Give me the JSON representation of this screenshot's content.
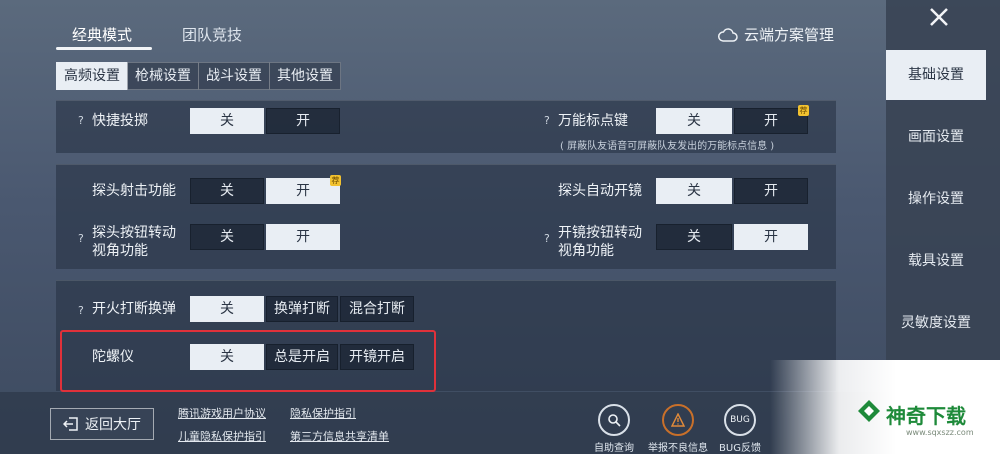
{
  "mode_tabs": [
    {
      "label": "经典模式",
      "active": true
    },
    {
      "label": "团队竞技",
      "active": false
    }
  ],
  "cloud": {
    "label": "云端方案管理",
    "icon": "cloud-icon"
  },
  "sub_tabs": [
    {
      "label": "高频设置",
      "active": true
    },
    {
      "label": "枪械设置",
      "active": false
    },
    {
      "label": "战斗设置",
      "active": false
    },
    {
      "label": "其他设置",
      "active": false
    }
  ],
  "settings": {
    "quick_throw": {
      "help": "?",
      "label": "快捷投掷",
      "options": [
        "关",
        "开"
      ],
      "selected": "关"
    },
    "universal_mark": {
      "help": "?",
      "label": "万能标点键",
      "options": [
        "关",
        "开"
      ],
      "selected": "关",
      "badge": "荐",
      "note": "( 屏蔽队友语音可屏蔽队友发出的万能标点信息 )"
    },
    "peek_fire": {
      "label": "探头射击功能",
      "options": [
        "关",
        "开"
      ],
      "selected": "开",
      "badge": "荐"
    },
    "peek_auto_scope": {
      "label": "探头自动开镜",
      "options": [
        "关",
        "开"
      ],
      "selected": "关"
    },
    "peek_button_rotate": {
      "help": "?",
      "label_line1": "探头按钮转动",
      "label_line2": "视角功能",
      "options": [
        "关",
        "开"
      ],
      "selected": "开"
    },
    "scope_button_rotate": {
      "help": "?",
      "label_line1": "开镜按钮转动",
      "label_line2": "视角功能",
      "options": [
        "关",
        "开"
      ],
      "selected": "开"
    },
    "fire_interrupt_reload": {
      "help": "?",
      "label": "开火打断换弹",
      "options": [
        "关",
        "换弹打断",
        "混合打断"
      ],
      "selected": "关"
    },
    "gyroscope": {
      "label": "陀螺仪",
      "options": [
        "关",
        "总是开启",
        "开镜开启"
      ],
      "selected": "关"
    }
  },
  "sidebar": {
    "close_icon": "close-icon",
    "items": [
      {
        "label": "基础设置",
        "active": true
      },
      {
        "label": "画面设置",
        "active": false
      },
      {
        "label": "操作设置",
        "active": false
      },
      {
        "label": "载具设置",
        "active": false
      },
      {
        "label": "灵敏度设置",
        "active": false
      }
    ]
  },
  "footer": {
    "back_label": "返回大厅",
    "back_icon": "exit-icon",
    "links": [
      "腾讯游戏用户协议",
      "隐私保护指引",
      "儿童隐私保护指引",
      "第三方信息共享清单"
    ],
    "buttons": [
      {
        "label": "自助查询",
        "icon": "search-icon"
      },
      {
        "label": "举报不良信息",
        "icon": "warning-icon"
      },
      {
        "label": "BUG反馈",
        "icon": "bug-icon",
        "glyph": "BUG"
      }
    ]
  },
  "watermark": {
    "text": "神奇下载",
    "url": "www.sqxszz.com"
  },
  "colors": {
    "highlight": "#e0313a",
    "badge": "#f2c230",
    "watermark": "#1e8a3a"
  }
}
